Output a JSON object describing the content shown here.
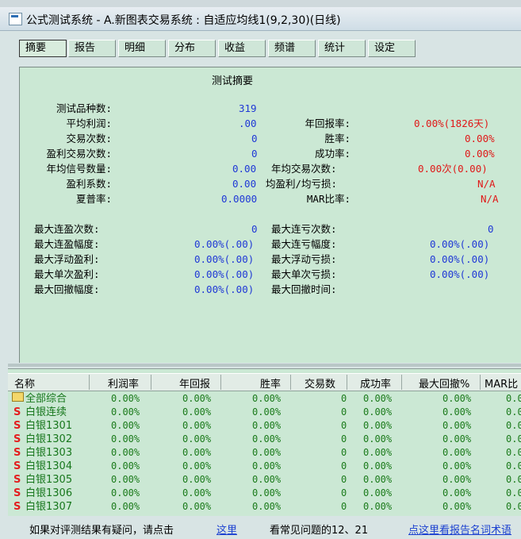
{
  "window": {
    "title": "公式测试系统 - A.新图表交易系统 : 自适应均线1(9,2,30)(日线)"
  },
  "tabs": [
    "摘要",
    "报告",
    "明细",
    "分布",
    "收益",
    "频谱",
    "统计",
    "设定"
  ],
  "summary": {
    "heading": "测试摘要",
    "left": [
      {
        "label": "测试品种数:",
        "value": "319"
      },
      {
        "label": "平均利润:",
        "value": ".00"
      },
      {
        "label": "交易次数:",
        "value": "0"
      },
      {
        "label": "盈利交易次数:",
        "value": "0"
      },
      {
        "label": "年均信号数量:",
        "value": "0.00"
      },
      {
        "label": "盈利系数:",
        "value": "0.00"
      },
      {
        "label": "夏普率:",
        "value": "0.0000"
      }
    ],
    "right": [
      {
        "label": "年回报率:",
        "value": "0.00%(1826天)"
      },
      {
        "label": "胜率:",
        "value": "0.00%"
      },
      {
        "label": "成功率:",
        "value": "0.00%"
      },
      {
        "label": "年均交易次数:",
        "value": "0.00次(0.00)"
      },
      {
        "label": "均盈利/均亏损:",
        "value": "N/A"
      },
      {
        "label": "MAR比率:",
        "value": "N/A"
      }
    ],
    "left2": [
      {
        "label": "最大连盈次数:",
        "value": "0"
      },
      {
        "label": "最大连盈幅度:",
        "value": "0.00%(.00)"
      },
      {
        "label": "最大浮动盈利:",
        "value": "0.00%(.00)"
      },
      {
        "label": "最大单次盈利:",
        "value": "0.00%(.00)"
      },
      {
        "label": "最大回撤幅度:",
        "value": "0.00%(.00)"
      }
    ],
    "right2": [
      {
        "label": "最大连亏次数:",
        "value": "0"
      },
      {
        "label": "最大连亏幅度:",
        "value": "0.00%(.00)"
      },
      {
        "label": "最大浮动亏损:",
        "value": "0.00%(.00)"
      },
      {
        "label": "最大单次亏损:",
        "value": "0.00%(.00)"
      },
      {
        "label": "最大回撤时间:",
        "value": ""
      }
    ]
  },
  "table": {
    "columns": [
      "名称",
      "利润率",
      "年回报",
      "胜率",
      "交易数",
      "成功率",
      "最大回撤%",
      "MAR比"
    ],
    "rows": [
      {
        "name": "全部综合",
        "icon": "folder",
        "cells": [
          "0.00%",
          "0.00%",
          "0.00%",
          "0",
          "0.00%",
          "0.00%",
          "0.0"
        ]
      },
      {
        "name": "白银连续",
        "icon": "S",
        "cells": [
          "0.00%",
          "0.00%",
          "0.00%",
          "0",
          "0.00%",
          "0.00%",
          "0.0"
        ]
      },
      {
        "name": "白银1301",
        "icon": "S",
        "cells": [
          "0.00%",
          "0.00%",
          "0.00%",
          "0",
          "0.00%",
          "0.00%",
          "0.0"
        ]
      },
      {
        "name": "白银1302",
        "icon": "S",
        "cells": [
          "0.00%",
          "0.00%",
          "0.00%",
          "0",
          "0.00%",
          "0.00%",
          "0.0"
        ]
      },
      {
        "name": "白银1303",
        "icon": "S",
        "cells": [
          "0.00%",
          "0.00%",
          "0.00%",
          "0",
          "0.00%",
          "0.00%",
          "0.0"
        ]
      },
      {
        "name": "白银1304",
        "icon": "S",
        "cells": [
          "0.00%",
          "0.00%",
          "0.00%",
          "0",
          "0.00%",
          "0.00%",
          "0.0"
        ]
      },
      {
        "name": "白银1305",
        "icon": "S",
        "cells": [
          "0.00%",
          "0.00%",
          "0.00%",
          "0",
          "0.00%",
          "0.00%",
          "0.0"
        ]
      },
      {
        "name": "白银1306",
        "icon": "S",
        "cells": [
          "0.00%",
          "0.00%",
          "0.00%",
          "0",
          "0.00%",
          "0.00%",
          "0.0"
        ]
      },
      {
        "name": "白银1307",
        "icon": "S",
        "cells": [
          "0.00%",
          "0.00%",
          "0.00%",
          "0",
          "0.00%",
          "0.00%",
          "0.0"
        ]
      }
    ]
  },
  "footer": {
    "prompt": "如果对评测结果有疑问，请点击",
    "here_link": "这里",
    "faq": "看常见问题的12、21",
    "terms_link": "点这里看报告名词术语"
  },
  "colors": {
    "value_blue": "#1f38d6",
    "value_red": "#e01818",
    "row_green": "#17771c"
  }
}
